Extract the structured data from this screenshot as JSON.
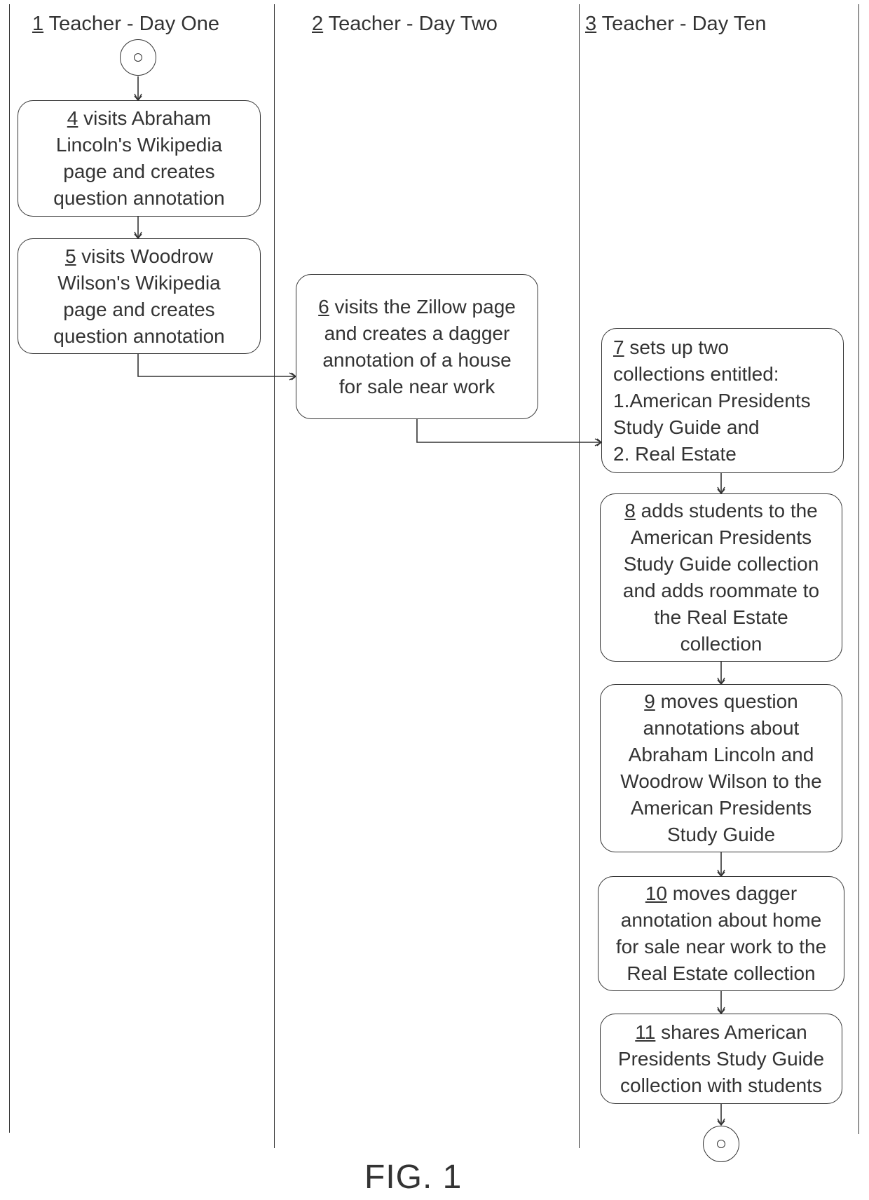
{
  "figure_label": "FIG. 1",
  "lanes": [
    {
      "num": "1",
      "title": " Teacher - Day One"
    },
    {
      "num": "2",
      "title": " Teacher - Day Two"
    },
    {
      "num": "3",
      "title": " Teacher - Day Ten"
    }
  ],
  "activities": {
    "a4": {
      "num": "4",
      "text": " visits Abraham\nLincoln's Wikipedia\npage and creates\nquestion annotation",
      "lane": "1"
    },
    "a5": {
      "num": "5",
      "text": " visits Woodrow\nWilson's Wikipedia\npage and creates\nquestion annotation",
      "lane": "1"
    },
    "a6": {
      "num": "6",
      "text": " visits the Zillow page\nand creates a dagger\nannotation of a house\nfor sale near work",
      "lane": "2"
    },
    "a7": {
      "num": "7",
      "text": " sets up two\ncollections entitled:\n1.American Presidents\nStudy Guide and\n2. Real Estate",
      "lane": "3"
    },
    "a8": {
      "num": "8",
      "text": " adds students to the\nAmerican Presidents\nStudy Guide collection\nand adds roommate to\nthe Real Estate\ncollection",
      "lane": "3"
    },
    "a9": {
      "num": "9",
      "text": " moves question\nannotations about\nAbraham Lincoln and\nWoodrow Wilson to the\nAmerican Presidents\nStudy Guide",
      "lane": "3"
    },
    "a10": {
      "num": "10",
      "text": " moves dagger\nannotation about home\nfor sale near work to the\nReal Estate collection",
      "lane": "3"
    },
    "a11": {
      "num": "11",
      "text": " shares American\nPresidents Study Guide\ncollection with students",
      "lane": "3"
    }
  },
  "flow": [
    "start",
    "4",
    "5",
    "6",
    "7",
    "8",
    "9",
    "10",
    "11",
    "end"
  ]
}
